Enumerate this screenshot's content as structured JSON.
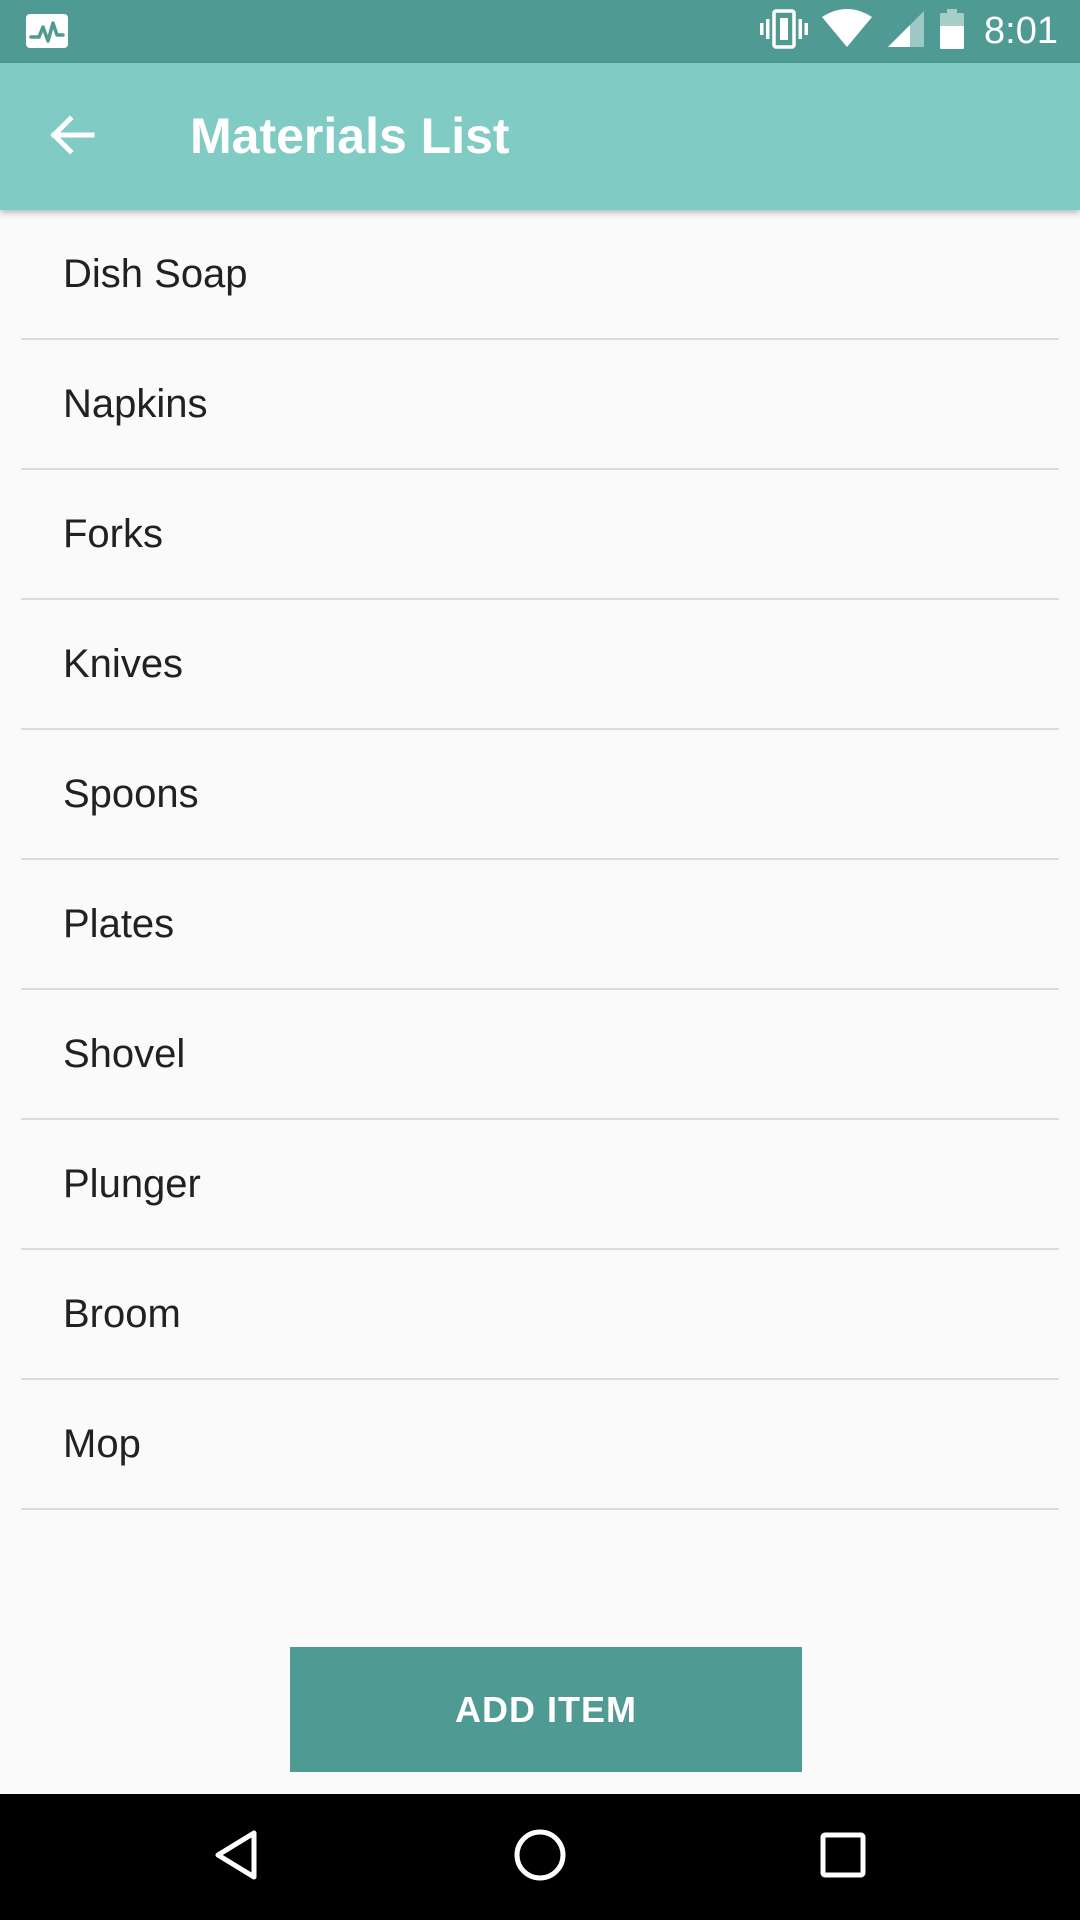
{
  "status_bar": {
    "time": "8:01",
    "icons": [
      "activity-monitor-icon",
      "vibrate-icon",
      "wifi-icon",
      "cell-signal-icon",
      "battery-icon"
    ]
  },
  "app_bar": {
    "title": "Materials List",
    "back_icon": "back-arrow-icon"
  },
  "materials": {
    "items": [
      {
        "label": "Dish Soap"
      },
      {
        "label": "Napkins"
      },
      {
        "label": "Forks"
      },
      {
        "label": "Knives"
      },
      {
        "label": "Spoons"
      },
      {
        "label": "Plates"
      },
      {
        "label": "Shovel"
      },
      {
        "label": "Plunger"
      },
      {
        "label": "Broom"
      },
      {
        "label": "Mop"
      }
    ]
  },
  "add_button": {
    "label": "ADD ITEM"
  },
  "nav_bar": {
    "icons": [
      "back-triangle-icon",
      "home-circle-icon",
      "recents-square-icon"
    ]
  },
  "colors": {
    "status_bar": "#4f9b93",
    "app_bar": "#80cbc4",
    "button": "#4f9b93",
    "background": "#fafafa",
    "divider": "#dcdcdc",
    "text": "#212121"
  }
}
